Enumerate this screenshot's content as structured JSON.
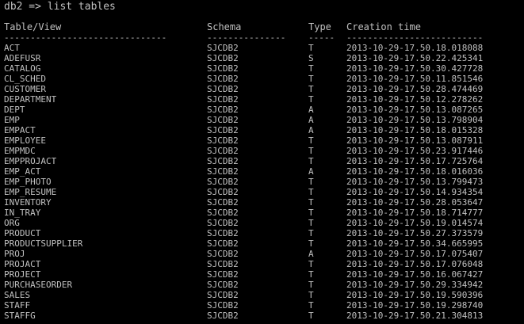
{
  "prompt": "db2 => list tables",
  "columns": {
    "table_view": "Table/View",
    "schema": "Schema",
    "type": "Type",
    "creation_time": "Creation time"
  },
  "separators": {
    "table_view": "-------------------------------",
    "schema": "---------------",
    "type": "-----",
    "creation_time": "--------------------------"
  },
  "rows": [
    {
      "name": "ACT",
      "schema": "SJCDB2",
      "type": "T",
      "created": "2013-10-29-17.50.18.018088"
    },
    {
      "name": "ADEFUSR",
      "schema": "SJCDB2",
      "type": "S",
      "created": "2013-10-29-17.50.22.425341"
    },
    {
      "name": "CATALOG",
      "schema": "SJCDB2",
      "type": "T",
      "created": "2013-10-29-17.50.30.427728"
    },
    {
      "name": "CL_SCHED",
      "schema": "SJCDB2",
      "type": "T",
      "created": "2013-10-29-17.50.11.851546"
    },
    {
      "name": "CUSTOMER",
      "schema": "SJCDB2",
      "type": "T",
      "created": "2013-10-29-17.50.28.474469"
    },
    {
      "name": "DEPARTMENT",
      "schema": "SJCDB2",
      "type": "T",
      "created": "2013-10-29-17.50.12.278262"
    },
    {
      "name": "DEPT",
      "schema": "SJCDB2",
      "type": "A",
      "created": "2013-10-29-17.50.13.087265"
    },
    {
      "name": "EMP",
      "schema": "SJCDB2",
      "type": "A",
      "created": "2013-10-29-17.50.13.798904"
    },
    {
      "name": "EMPACT",
      "schema": "SJCDB2",
      "type": "A",
      "created": "2013-10-29-17.50.18.015328"
    },
    {
      "name": "EMPLOYEE",
      "schema": "SJCDB2",
      "type": "T",
      "created": "2013-10-29-17.50.13.087911"
    },
    {
      "name": "EMPMDC",
      "schema": "SJCDB2",
      "type": "T",
      "created": "2013-10-29-17.50.23.917446"
    },
    {
      "name": "EMPPROJACT",
      "schema": "SJCDB2",
      "type": "T",
      "created": "2013-10-29-17.50.17.725764"
    },
    {
      "name": "EMP_ACT",
      "schema": "SJCDB2",
      "type": "A",
      "created": "2013-10-29-17.50.18.016036"
    },
    {
      "name": "EMP_PHOTO",
      "schema": "SJCDB2",
      "type": "T",
      "created": "2013-10-29-17.50.13.799473"
    },
    {
      "name": "EMP_RESUME",
      "schema": "SJCDB2",
      "type": "T",
      "created": "2013-10-29-17.50.14.934354"
    },
    {
      "name": "INVENTORY",
      "schema": "SJCDB2",
      "type": "T",
      "created": "2013-10-29-17.50.28.053647"
    },
    {
      "name": "IN_TRAY",
      "schema": "SJCDB2",
      "type": "T",
      "created": "2013-10-29-17.50.18.714777"
    },
    {
      "name": "ORG",
      "schema": "SJCDB2",
      "type": "T",
      "created": "2013-10-29-17.50.19.014574"
    },
    {
      "name": "PRODUCT",
      "schema": "SJCDB2",
      "type": "T",
      "created": "2013-10-29-17.50.27.373579"
    },
    {
      "name": "PRODUCTSUPPLIER",
      "schema": "SJCDB2",
      "type": "T",
      "created": "2013-10-29-17.50.34.665995"
    },
    {
      "name": "PROJ",
      "schema": "SJCDB2",
      "type": "A",
      "created": "2013-10-29-17.50.17.075407"
    },
    {
      "name": "PROJACT",
      "schema": "SJCDB2",
      "type": "T",
      "created": "2013-10-29-17.50.17.076048"
    },
    {
      "name": "PROJECT",
      "schema": "SJCDB2",
      "type": "T",
      "created": "2013-10-29-17.50.16.067427"
    },
    {
      "name": "PURCHASEORDER",
      "schema": "SJCDB2",
      "type": "T",
      "created": "2013-10-29-17.50.29.334942"
    },
    {
      "name": "SALES",
      "schema": "SJCDB2",
      "type": "T",
      "created": "2013-10-29-17.50.19.590396"
    },
    {
      "name": "STAFF",
      "schema": "SJCDB2",
      "type": "T",
      "created": "2013-10-29-17.50.19.298740"
    },
    {
      "name": "STAFFG",
      "schema": "SJCDB2",
      "type": "T",
      "created": "2013-10-29-17.50.21.304813"
    }
  ],
  "colors": {
    "background": "#000000",
    "text": "#c0c0c0"
  }
}
